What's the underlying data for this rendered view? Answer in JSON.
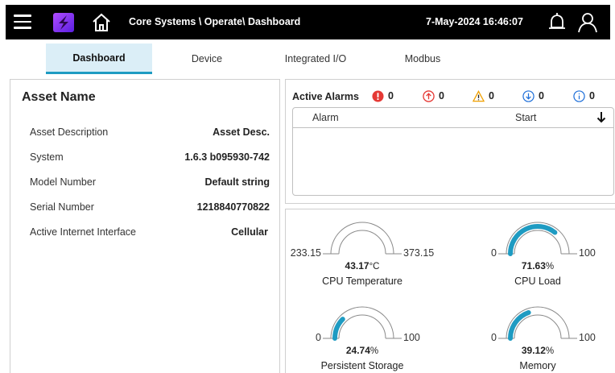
{
  "header": {
    "breadcrumb": "Core Systems \\ Operate\\ Dashboard",
    "datetime": "7-May-2024 16:46:07",
    "brand_color": "#7b2ff7",
    "icons": [
      "menu-icon",
      "logo-icon",
      "home-icon",
      "bell-icon",
      "user-icon"
    ]
  },
  "tabs": [
    {
      "label": "Dashboard",
      "active": true
    },
    {
      "label": "Device",
      "active": false
    },
    {
      "label": "Integrated I/O",
      "active": false
    },
    {
      "label": "Modbus",
      "active": false
    }
  ],
  "asset": {
    "title": "Asset Name",
    "rows": [
      {
        "label": "Asset Description",
        "value": "Asset Desc."
      },
      {
        "label": "System",
        "value": "1.6.3 b095930-742"
      },
      {
        "label": "Model Number",
        "value": "Default string"
      },
      {
        "label": "Serial Number",
        "value": "1218840770822"
      },
      {
        "label": "Active Internet Interface",
        "value": "Cellular"
      }
    ]
  },
  "alarms": {
    "title": "Active Alarms",
    "counts": [
      {
        "type": "critical",
        "icon": "critical-alert-icon",
        "color": "#e53935",
        "value": "0"
      },
      {
        "type": "major",
        "icon": "up-arrow-circle-icon",
        "color": "#e53935",
        "value": "0"
      },
      {
        "type": "warning",
        "icon": "warning-triangle-icon",
        "color": "#f0a000",
        "value": "0"
      },
      {
        "type": "minor",
        "icon": "down-arrow-circle-icon",
        "color": "#1e6fd9",
        "value": "0"
      },
      {
        "type": "info",
        "icon": "info-circle-icon",
        "color": "#1e6fd9",
        "value": "0"
      }
    ],
    "columns": {
      "alarm": "Alarm",
      "start": "Start"
    },
    "rows": []
  },
  "gauges": {
    "accent": "#1e9bc2",
    "items": [
      {
        "label": "CPU Temperature",
        "min": "233.15",
        "max": "373.15",
        "value": "43.17",
        "unit": "°C",
        "fraction": 0
      },
      {
        "label": "CPU Load",
        "min": "0",
        "max": "100",
        "value": "71.63",
        "unit": "%",
        "fraction": 0.7163
      },
      {
        "label": "Persistent Storage",
        "min": "0",
        "max": "100",
        "value": "24.74",
        "unit": "%",
        "fraction": 0.2474
      },
      {
        "label": "Memory",
        "min": "0",
        "max": "100",
        "value": "39.12",
        "unit": "%",
        "fraction": 0.3912
      }
    ]
  }
}
